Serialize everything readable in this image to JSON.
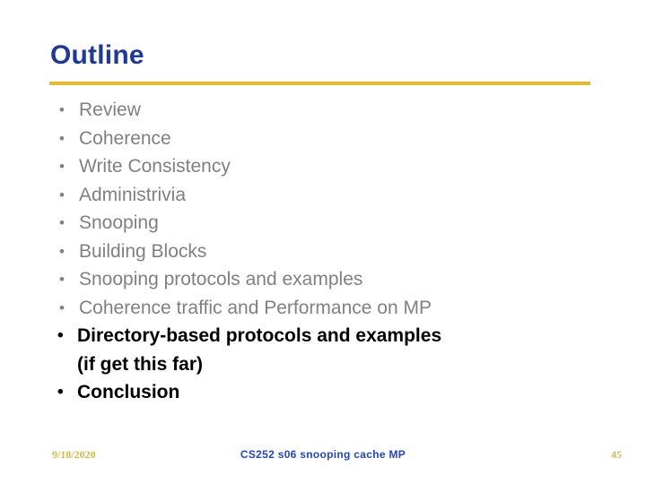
{
  "slide": {
    "title": "Outline",
    "title_color": "#1f3a93",
    "rule_color": "#eab92a",
    "background_color": "#ffffff",
    "muted_text_color": "#808080",
    "accent_text_color": "#000000",
    "bullet_glyph": "•",
    "bullets": [
      {
        "label": "Review",
        "emphasis": "muted"
      },
      {
        "label": "Coherence",
        "emphasis": "muted"
      },
      {
        "label": "Write Consistency",
        "emphasis": "muted"
      },
      {
        "label": "Administrivia",
        "emphasis": "muted"
      },
      {
        "label": "Snooping",
        "emphasis": "muted"
      },
      {
        "label": "Building Blocks",
        "emphasis": "muted"
      },
      {
        "label": "Snooping protocols and examples",
        "emphasis": "muted"
      },
      {
        "label": "Coherence traffic and Performance on MP",
        "emphasis": "muted"
      },
      {
        "label": "Directory-based protocols and examples\n(if get this far)",
        "emphasis": "accent"
      },
      {
        "label": "Conclusion",
        "emphasis": "accent"
      }
    ]
  },
  "footer": {
    "date": "9/18/2020",
    "center": "CS252 s06 snooping cache MP",
    "page_number": "45",
    "date_color": "#d4b84a",
    "center_color": "#2346b8"
  }
}
